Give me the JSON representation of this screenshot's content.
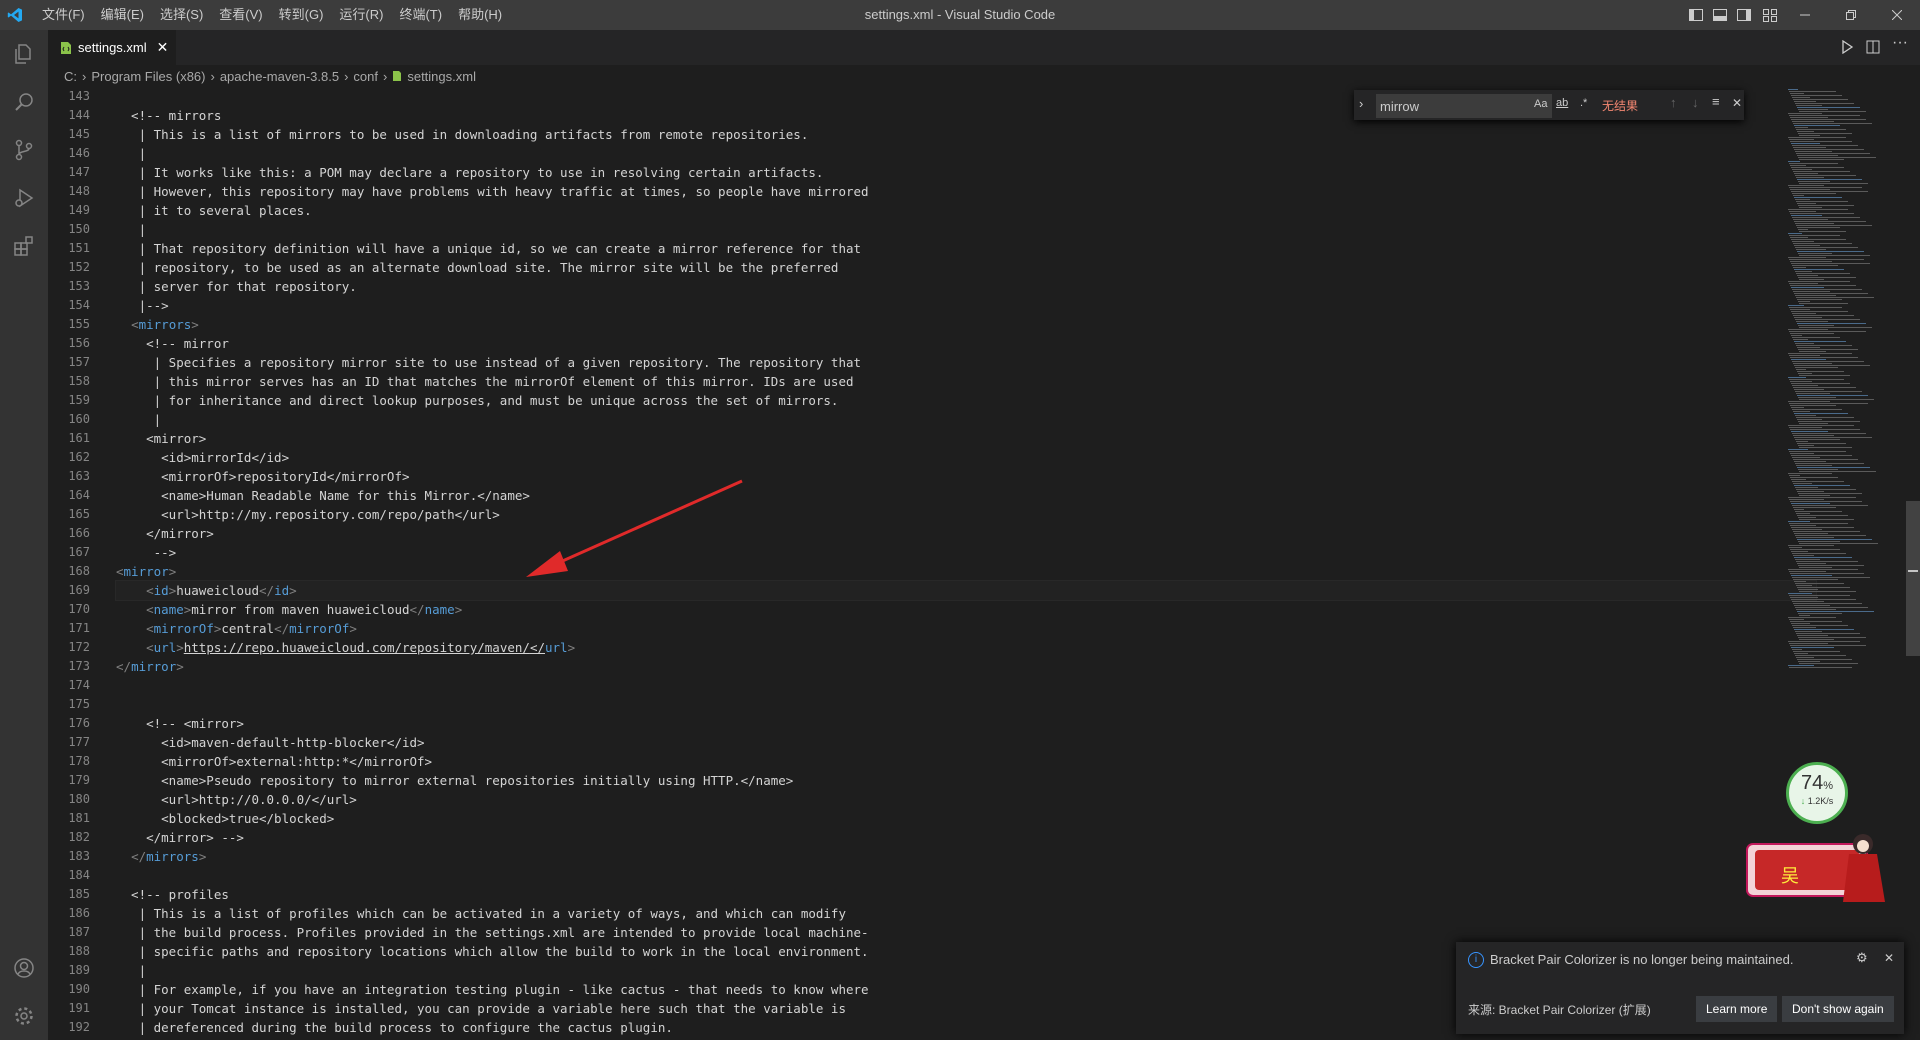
{
  "titlebar": {
    "menu": [
      "文件(F)",
      "编辑(E)",
      "选择(S)",
      "查看(V)",
      "转到(G)",
      "运行(R)",
      "终端(T)",
      "帮助(H)"
    ],
    "title": "settings.xml - Visual Studio Code"
  },
  "tab": {
    "label": "settings.xml"
  },
  "breadcrumb": [
    "C:",
    "Program Files (x86)",
    "apache-maven-3.8.5",
    "conf",
    "settings.xml"
  ],
  "find": {
    "value": "mirrow",
    "opt_case": "Aa",
    "opt_word": "ab",
    "opt_regex": ".*",
    "result": "无结果"
  },
  "editor": {
    "line_numbers": [
      "143",
      "144",
      "145",
      "146",
      "147",
      "148",
      "149",
      "150",
      "151",
      "152",
      "153",
      "154",
      "155",
      "156",
      "157",
      "158",
      "159",
      "160",
      "161",
      "162",
      "163",
      "164",
      "165",
      "166",
      "167",
      "168",
      "169",
      "170",
      "171",
      "172",
      "173",
      "174",
      "175",
      "176",
      "177",
      "178",
      "179",
      "180",
      "181",
      "182",
      "183",
      "184",
      "185",
      "186",
      "187",
      "188",
      "189",
      "190",
      "191",
      "192"
    ],
    "lines": [
      "",
      "  <!-- mirrors",
      "   | This is a list of mirrors to be used in downloading artifacts from remote repositories.",
      "   |",
      "   | It works like this: a POM may declare a repository to use in resolving certain artifacts.",
      "   | However, this repository may have problems with heavy traffic at times, so people have mirrored",
      "   | it to several places.",
      "   |",
      "   | That repository definition will have a unique id, so we can create a mirror reference for that",
      "   | repository, to be used as an alternate download site. The mirror site will be the preferred",
      "   | server for that repository.",
      "   |-->",
      "  <mirrors>",
      "    <!-- mirror",
      "     | Specifies a repository mirror site to use instead of a given repository. The repository that",
      "     | this mirror serves has an ID that matches the mirrorOf element of this mirror. IDs are used",
      "     | for inheritance and direct lookup purposes, and must be unique across the set of mirrors.",
      "     |",
      "    <mirror>",
      "      <id>mirrorId</id>",
      "      <mirrorOf>repositoryId</mirrorOf>",
      "      <name>Human Readable Name for this Mirror.</name>",
      "      <url>http://my.repository.com/repo/path</url>",
      "    </mirror>",
      "     -->",
      "<mirror>",
      "    <id>huaweicloud</id>",
      "    <name>mirror from maven huaweicloud</name>",
      "    <mirrorOf>central</mirrorOf>",
      "    <url>https://repo.huaweicloud.com/repository/maven/</url>",
      "</mirror>",
      "",
      "",
      "    <!-- <mirror>",
      "      <id>maven-default-http-blocker</id>",
      "      <mirrorOf>external:http:*</mirrorOf>",
      "      <name>Pseudo repository to mirror external repositories initially using HTTP.</name>",
      "      <url>http://0.0.0.0/</url>",
      "      <blocked>true</blocked>",
      "    </mirror> -->",
      "  </mirrors>",
      "",
      "  <!-- profiles",
      "   | This is a list of profiles which can be activated in a variety of ways, and which can modify",
      "   | the build process. Profiles provided in the settings.xml are intended to provide local machine-",
      "   | specific paths and repository locations which allow the build to work in the local environment.",
      "   |",
      "   | For example, if you have an integration testing plugin - like cactus - that needs to know where",
      "   | your Tomcat instance is installed, you can provide a variable here such that the variable is",
      "   | dereferenced during the build process to configure the cactus plugin."
    ]
  },
  "speed_widget": {
    "percent": "74",
    "unit": "%",
    "rate": "1.2K/s"
  },
  "mascot": {
    "text": "吴"
  },
  "notification": {
    "message": "Bracket Pair Colorizer is no longer being maintained.",
    "source": "来源: Bracket Pair Colorizer (扩展)",
    "learn_more": "Learn more",
    "dont_show": "Don't show again"
  },
  "colors": {
    "tag": "#569cd6",
    "bracket": "#808080",
    "arrow": "#e02a2a",
    "find_noresult": "#f48771"
  }
}
